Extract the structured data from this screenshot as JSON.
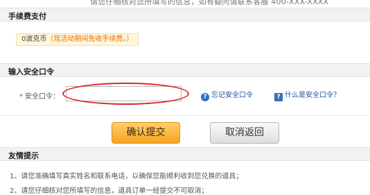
{
  "top_strip": {
    "text": "请您仔细核对您所填写的信息，如有疑问请联系客服 400-XXX-XXXX"
  },
  "fee_section": {
    "title": "手续费支付",
    "amount": "0波克币",
    "note": "（现活动期间免收手续费。）"
  },
  "password_section": {
    "title": "输入安全口令",
    "required_mark": "*",
    "label": "安全口令：",
    "input_value": "",
    "forgot_link": "忘记安全口令",
    "what_link": "什么是安全口令？"
  },
  "actions": {
    "submit_label": "确认提交",
    "cancel_label": "取消返回"
  },
  "tips_section": {
    "title": "友情提示",
    "items": [
      "1、请您准确填写真实姓名和联系电话，以确保您能顺利收到您兑换的道具；",
      "2、请您仔细核对您所填写的信息，道具订单一经提交不可取消；"
    ]
  },
  "colors": {
    "accent_orange": "#f6a521",
    "note_orange": "#ee6f00",
    "link_blue": "#1a4fa3",
    "highlight_red": "#d9262c",
    "header_gray": "#f2f2f2"
  },
  "icons": {
    "forgot": "question-circle-icon",
    "what": "help-book-icon"
  }
}
